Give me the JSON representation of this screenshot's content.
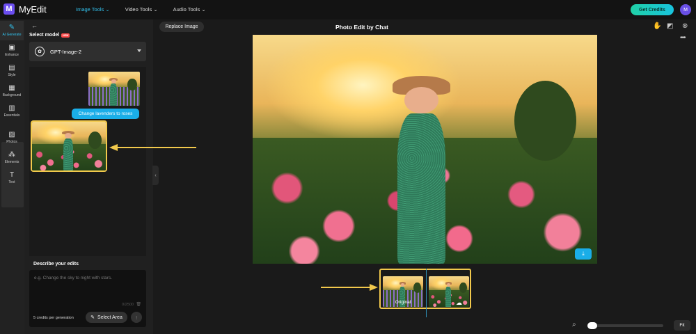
{
  "app": {
    "name": "MyEdit",
    "logo_letter": "M"
  },
  "nav": {
    "image_tools": "Image Tools",
    "video_tools": "Video Tools",
    "audio_tools": "Audio Tools"
  },
  "header": {
    "get_credits": "Get Credits",
    "avatar_letter": "M"
  },
  "rail": {
    "items": [
      {
        "label": "AI Generate",
        "icon": "wand-icon"
      },
      {
        "label": "Enhance",
        "icon": "enhance-icon"
      },
      {
        "label": "Style",
        "icon": "style-icon"
      },
      {
        "label": "Background",
        "icon": "background-icon"
      },
      {
        "label": "Essentials",
        "icon": "essentials-icon"
      },
      {
        "label": "Photos",
        "icon": "photo-icon"
      },
      {
        "label": "Elements",
        "icon": "elements-icon"
      },
      {
        "label": "Text",
        "icon": "text-icon"
      }
    ]
  },
  "panel": {
    "select_model_label": "Select model",
    "new_badge": "NEW",
    "model_value": "GPT-Image-2",
    "chat_message": "Change lavenders to roses",
    "describe_label": "Describe your edits",
    "describe_placeholder": "e.g. Change the sky to night with stars.",
    "counter": "0/2500",
    "credits_per_generation": "5 credits per generation",
    "select_area": "Select Area"
  },
  "canvas": {
    "replace_image": "Replace Image",
    "title": "Photo Edit by Chat",
    "original_label": "Original",
    "fit": "Fit",
    "zoom_level": 0.0
  },
  "colors": {
    "accent": "#1aaee8",
    "highlight": "#f2c94c",
    "credits_gradient": "#20d0a6"
  }
}
